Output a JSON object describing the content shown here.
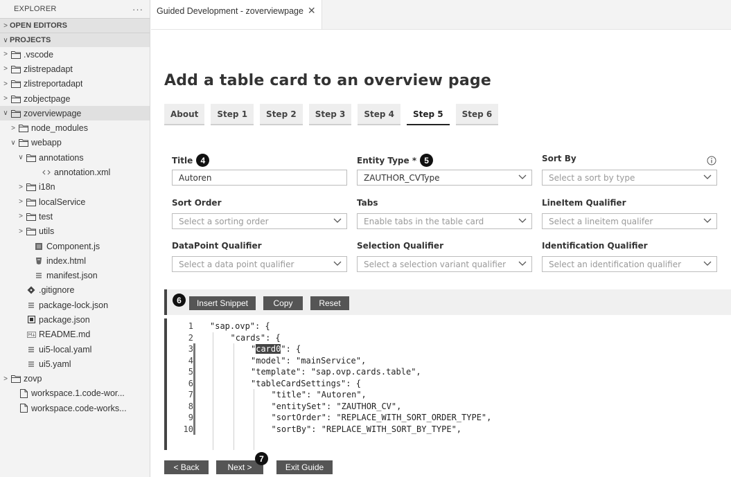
{
  "explorer": {
    "title": "EXPLORER",
    "more": "···",
    "open_editors": "OPEN EDITORS",
    "projects": "PROJECTS",
    "tree": [
      {
        "label": ".vscode",
        "chev": ">",
        "icon": "folder",
        "indent": 0
      },
      {
        "label": "zlistrepadapt",
        "chev": ">",
        "icon": "folder",
        "indent": 0
      },
      {
        "label": "zlistreportadapt",
        "chev": ">",
        "icon": "folder",
        "indent": 0
      },
      {
        "label": "zobjectpage",
        "chev": ">",
        "icon": "folder",
        "indent": 0
      },
      {
        "label": "zoverviewpage",
        "chev": "∨",
        "icon": "folder",
        "indent": 0,
        "selected": true
      },
      {
        "label": "node_modules",
        "chev": ">",
        "icon": "folder",
        "indent": 1
      },
      {
        "label": "webapp",
        "chev": "∨",
        "icon": "folder",
        "indent": 1
      },
      {
        "label": "annotations",
        "chev": "∨",
        "icon": "folder",
        "indent": 2
      },
      {
        "label": "annotation.xml",
        "chev": "",
        "icon": "xml",
        "indent": 4
      },
      {
        "label": "i18n",
        "chev": ">",
        "icon": "folder",
        "indent": 2
      },
      {
        "label": "localService",
        "chev": ">",
        "icon": "folder",
        "indent": 2
      },
      {
        "label": "test",
        "chev": ">",
        "icon": "folder",
        "indent": 2
      },
      {
        "label": "utils",
        "chev": ">",
        "icon": "folder",
        "indent": 2
      },
      {
        "label": "Component.js",
        "chev": "",
        "icon": "js",
        "indent": 3
      },
      {
        "label": "index.html",
        "chev": "",
        "icon": "html",
        "indent": 3
      },
      {
        "label": "manifest.json",
        "chev": "",
        "icon": "json",
        "indent": 3
      },
      {
        "label": ".gitignore",
        "chev": "",
        "icon": "git",
        "indent": 2
      },
      {
        "label": "package-lock.json",
        "chev": "",
        "icon": "json",
        "indent": 2
      },
      {
        "label": "package.json",
        "chev": "",
        "icon": "npm",
        "indent": 2
      },
      {
        "label": "README.md",
        "chev": "",
        "icon": "md",
        "indent": 2
      },
      {
        "label": "ui5-local.yaml",
        "chev": "",
        "icon": "yaml",
        "indent": 2
      },
      {
        "label": "ui5.yaml",
        "chev": "",
        "icon": "yaml",
        "indent": 2
      },
      {
        "label": "zovp",
        "chev": ">",
        "icon": "folder",
        "indent": 0
      },
      {
        "label": "workspace.1.code-wor...",
        "chev": "",
        "icon": "file",
        "indent": 1
      },
      {
        "label": "workspace.code-works...",
        "chev": "",
        "icon": "file",
        "indent": 1
      }
    ]
  },
  "editor_tab": {
    "label": "Guided Development - zoverviewpage",
    "close": "✕"
  },
  "guide": {
    "title": "Add a table card to an overview page",
    "steps": [
      {
        "label": "About",
        "active": false
      },
      {
        "label": "Step 1",
        "active": false
      },
      {
        "label": "Step 2",
        "active": false
      },
      {
        "label": "Step 3",
        "active": false
      },
      {
        "label": "Step 4",
        "active": false
      },
      {
        "label": "Step 5",
        "active": true
      },
      {
        "label": "Step 6",
        "active": false
      }
    ],
    "form": {
      "title_label": "Title",
      "title_value": "Autoren",
      "entity_label": "Entity Type *",
      "entity_value": "ZAUTHOR_CVType",
      "sortby_label": "Sort By",
      "sortby_placeholder": "Select a sort by type",
      "sortorder_label": "Sort Order",
      "sortorder_placeholder": "Select a sorting order",
      "tabs_label": "Tabs",
      "tabs_placeholder": "Enable tabs in the table card",
      "lineitem_label": "LineItem Qualifier",
      "lineitem_placeholder": "Select a lineitem qualifer",
      "datapoint_label": "DataPoint Qualifier",
      "datapoint_placeholder": "Select a data point qualifier",
      "selection_label": "Selection Qualifier",
      "selection_placeholder": "Select a selection variant qualifier",
      "identification_label": "Identification Qualifier",
      "identification_placeholder": "Select an identification qualifier"
    },
    "snippet": {
      "insert": "Insert Snippet",
      "copy": "Copy",
      "reset": "Reset"
    },
    "code_lines": [
      {
        "n": "1",
        "pre": "\"sap.ovp\": {",
        "hl": "",
        "post": "",
        "indent": 0
      },
      {
        "n": "2",
        "pre": "\"cards\": {",
        "hl": "",
        "post": "",
        "indent": 1
      },
      {
        "n": "3",
        "pre": "\"",
        "hl": "card0",
        "post": "\": {",
        "indent": 2
      },
      {
        "n": "4",
        "pre": "\"model\": \"mainService\",",
        "hl": "",
        "post": "",
        "indent": 2
      },
      {
        "n": "5",
        "pre": "\"template\": \"sap.ovp.cards.table\",",
        "hl": "",
        "post": "",
        "indent": 2
      },
      {
        "n": "6",
        "pre": "\"tableCardSettings\": {",
        "hl": "",
        "post": "",
        "indent": 2
      },
      {
        "n": "7",
        "pre": "\"title\": \"Autoren\",",
        "hl": "",
        "post": "",
        "indent": 3
      },
      {
        "n": "8",
        "pre": "\"entitySet\": \"ZAUTHOR_CV\",",
        "hl": "",
        "post": "",
        "indent": 3
      },
      {
        "n": "9",
        "pre": "\"sortOrder\": \"REPLACE_WITH_SORT_ORDER_TYPE\",",
        "hl": "",
        "post": "",
        "indent": 3
      },
      {
        "n": "10",
        "pre": "\"sortBy\": \"REPLACE_WITH_SORT_BY_TYPE\",",
        "hl": "",
        "post": "",
        "indent": 3
      }
    ],
    "nav": {
      "back": "< Back",
      "next": "Next >",
      "exit": "Exit Guide"
    },
    "callouts": {
      "c4": "4",
      "c5": "5",
      "c6": "6",
      "c7": "7"
    }
  }
}
